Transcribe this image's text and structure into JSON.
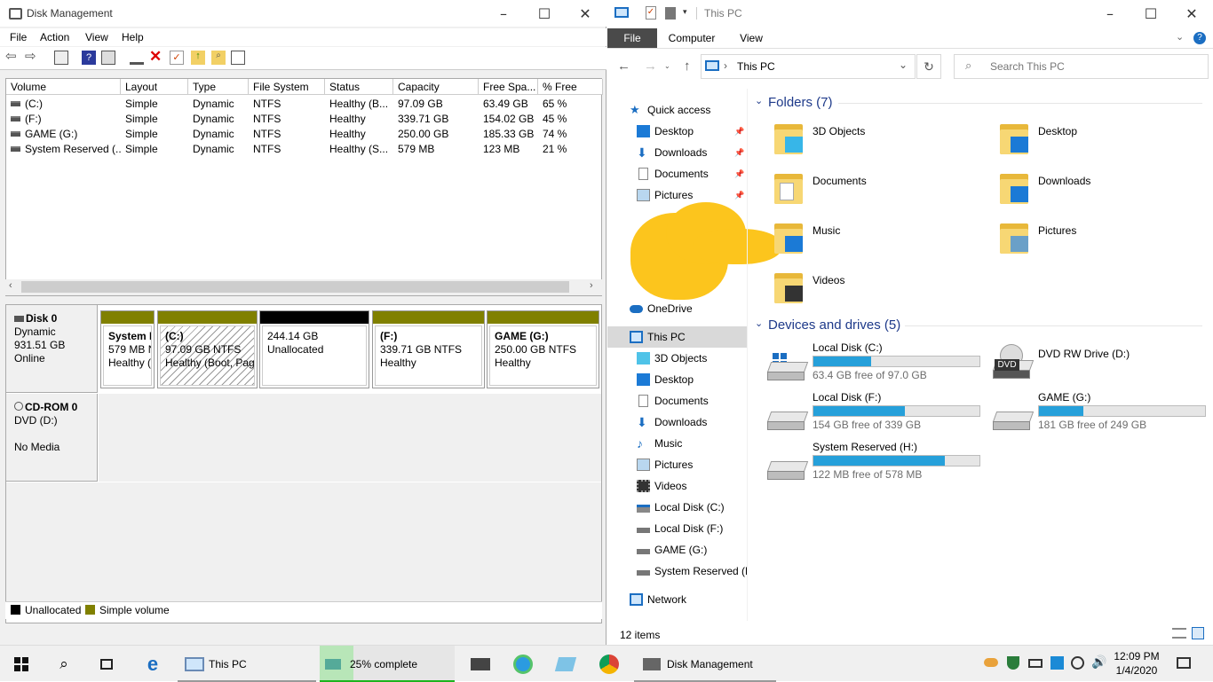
{
  "dm": {
    "title": "Disk Management",
    "menu": [
      "File",
      "Action",
      "View",
      "Help"
    ],
    "columns": [
      "Volume",
      "Layout",
      "Type",
      "File System",
      "Status",
      "Capacity",
      "Free Spa...",
      "% Free"
    ],
    "rows": [
      [
        "(C:)",
        "Simple",
        "Dynamic",
        "NTFS",
        "Healthy (B...",
        "97.09 GB",
        "63.49 GB",
        "65 %"
      ],
      [
        "(F:)",
        "Simple",
        "Dynamic",
        "NTFS",
        "Healthy",
        "339.71 GB",
        "154.02 GB",
        "45 %"
      ],
      [
        "GAME (G:)",
        "Simple",
        "Dynamic",
        "NTFS",
        "Healthy",
        "250.00 GB",
        "185.33 GB",
        "74 %"
      ],
      [
        "System Reserved (...",
        "Simple",
        "Dynamic",
        "NTFS",
        "Healthy (S...",
        "579 MB",
        "123 MB",
        "21 %"
      ]
    ],
    "disk0": {
      "name": "Disk 0",
      "type": "Dynamic",
      "size": "931.51 GB",
      "status": "Online"
    },
    "parts": [
      {
        "l1": "System F",
        "l2": "579 MB N",
        "l3": "Healthy ("
      },
      {
        "l1": "(C:)",
        "l2": "97.09 GB NTFS",
        "l3": "Healthy (Boot, Pag"
      },
      {
        "l1": "",
        "l2": "244.14 GB",
        "l3": "Unallocated"
      },
      {
        "l1": "(F:)",
        "l2": "339.71 GB NTFS",
        "l3": "Healthy"
      },
      {
        "l1": "GAME  (G:)",
        "l2": "250.00 GB NTFS",
        "l3": "Healthy"
      }
    ],
    "cdrom": {
      "name": "CD-ROM 0",
      "type": "DVD (D:)",
      "media": "No Media"
    },
    "legend": {
      "unalloc": "Unallocated",
      "simple": "Simple volume"
    }
  },
  "ex": {
    "title": "This PC",
    "tabs": {
      "file": "File",
      "computer": "Computer",
      "view": "View"
    },
    "address": "This PC",
    "search_placeholder": "Search This PC",
    "nav": {
      "quick": "Quick access",
      "desktop": "Desktop",
      "downloads": "Downloads",
      "documents": "Documents",
      "pictures": "Pictures",
      "onedrive": "OneDrive",
      "thispc": "This PC",
      "objects": "3D Objects",
      "music": "Music",
      "videos": "Videos",
      "c": "Local Disk (C:)",
      "f": "Local Disk (F:)",
      "g": "GAME (G:)",
      "h": "System Reserved (H",
      "network": "Network"
    },
    "folders_header": "Folders (7)",
    "folders": [
      "3D Objects",
      "Desktop",
      "Documents",
      "Downloads",
      "Music",
      "Pictures",
      "Videos"
    ],
    "devices_header": "Devices and drives (5)",
    "drives": [
      {
        "name": "Local Disk (C:)",
        "free": "63.4 GB free of 97.0 GB",
        "used": 0.35
      },
      {
        "name": "DVD RW Drive (D:)"
      },
      {
        "name": "Local Disk (F:)",
        "free": "154 GB free of 339 GB",
        "used": 0.55
      },
      {
        "name": "GAME (G:)",
        "free": "181 GB free of 249 GB",
        "used": 0.27
      },
      {
        "name": "System Reserved (H:)",
        "free": "122 MB free of 578 MB",
        "used": 0.79
      }
    ],
    "dvd_label": "DVD",
    "status": "12 items"
  },
  "taskbar": {
    "thispc": "This PC",
    "copy": "25% complete",
    "dm": "Disk Management",
    "time": "12:09 PM",
    "date": "1/4/2020",
    "progress": 0.25
  }
}
